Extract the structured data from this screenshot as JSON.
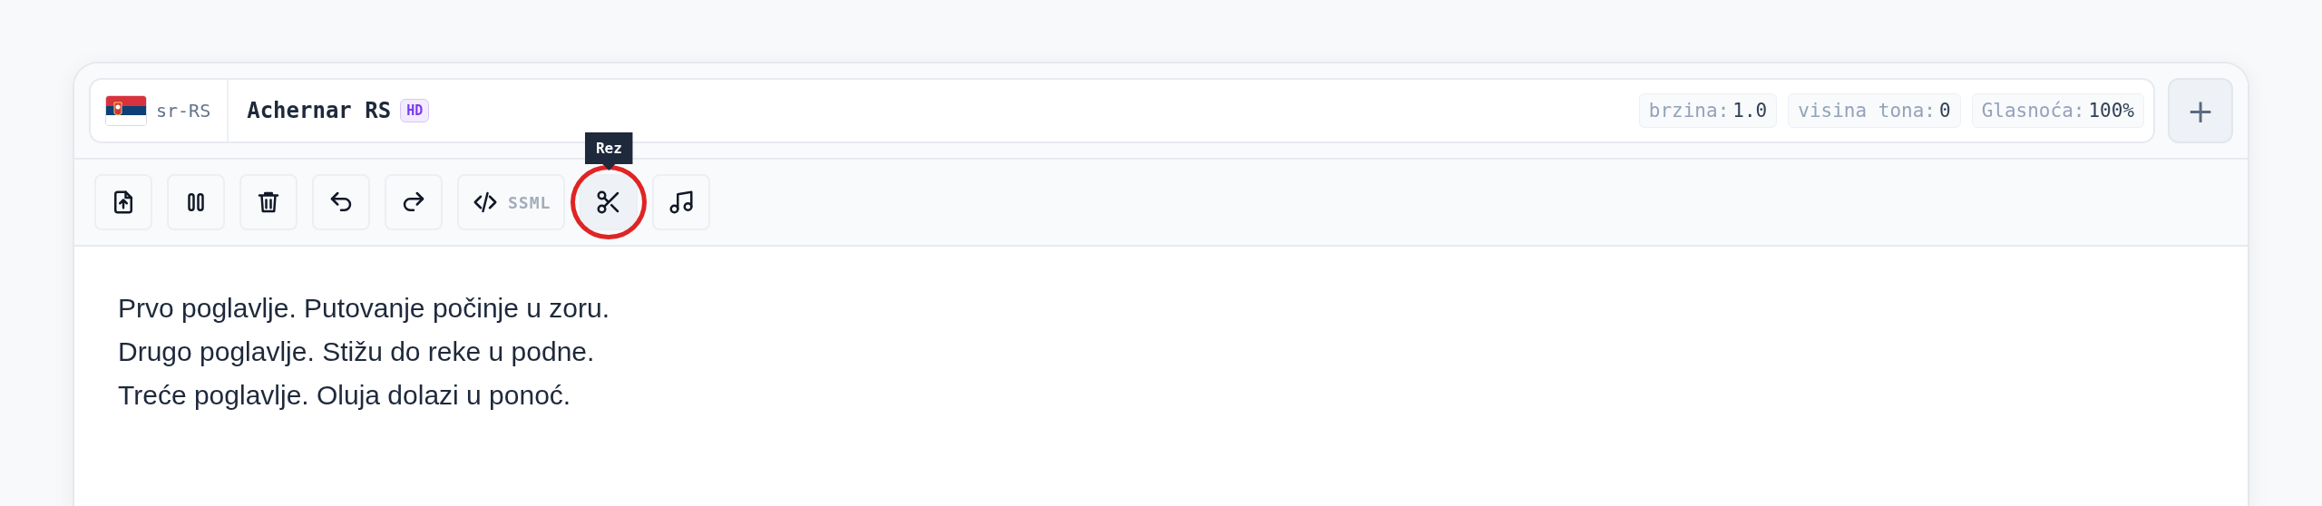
{
  "voice": {
    "locale": "sr-RS",
    "name": "Achernar RS",
    "badge": "HD"
  },
  "settings": [
    {
      "label": "brzina:",
      "value": "1.0"
    },
    {
      "label": "visina tona:",
      "value": "0"
    },
    {
      "label": "Glasnoća:",
      "value": "100%"
    }
  ],
  "add_button": {
    "label": "+"
  },
  "toolbar": [
    {
      "kind": "upload",
      "highlighted": false
    },
    {
      "kind": "pause",
      "highlighted": false
    },
    {
      "kind": "trash",
      "highlighted": false
    },
    {
      "kind": "undo",
      "highlighted": false
    },
    {
      "kind": "redo",
      "highlighted": false
    },
    {
      "kind": "ssml",
      "label": "SSML",
      "highlighted": false
    },
    {
      "kind": "cut",
      "tooltip": "Rez",
      "highlighted": true
    },
    {
      "kind": "music",
      "highlighted": false
    }
  ],
  "editor": {
    "lines": [
      "Prvo poglavlje. Putovanje počinje u zoru.",
      "Drugo poglavlje. Stižu do reke u podne.",
      "Treće poglavlje. Oluja dolazi u ponoć."
    ]
  }
}
